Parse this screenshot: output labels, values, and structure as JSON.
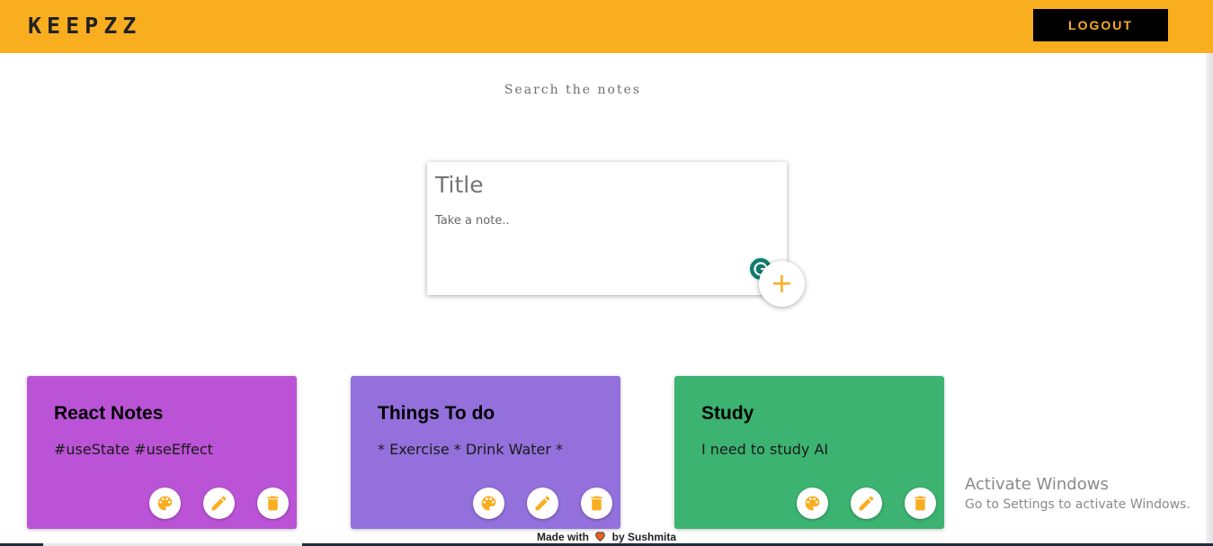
{
  "header": {
    "logo": "KEEPZZ",
    "logout_label": "LOGOUT",
    "background": "#f9ae20"
  },
  "search": {
    "placeholder": "Search the notes"
  },
  "note_form": {
    "title_placeholder": "Title",
    "body_placeholder": "Take a note..",
    "add_label": "+"
  },
  "notes": [
    {
      "title": "React Notes",
      "body": "#useState #useEffect",
      "color": "#bb53d6"
    },
    {
      "title": "Things To do",
      "body": "* Exercise * Drink Water *",
      "color": "#9370db"
    },
    {
      "title": "Study",
      "body": "I need to study AI",
      "color": "#3cb371"
    }
  ],
  "note_actions": [
    "palette-icon",
    "pencil-icon",
    "trash-icon"
  ],
  "watermark": {
    "title": "Activate Windows",
    "subtitle": "Go to Settings to activate Windows."
  },
  "footer": {
    "made_with": "Made with",
    "by": "by Sushmita"
  },
  "colors": {
    "accent": "#f9ae20",
    "logout_bg": "#000000",
    "grammar_icon": "#0f7b6c"
  }
}
